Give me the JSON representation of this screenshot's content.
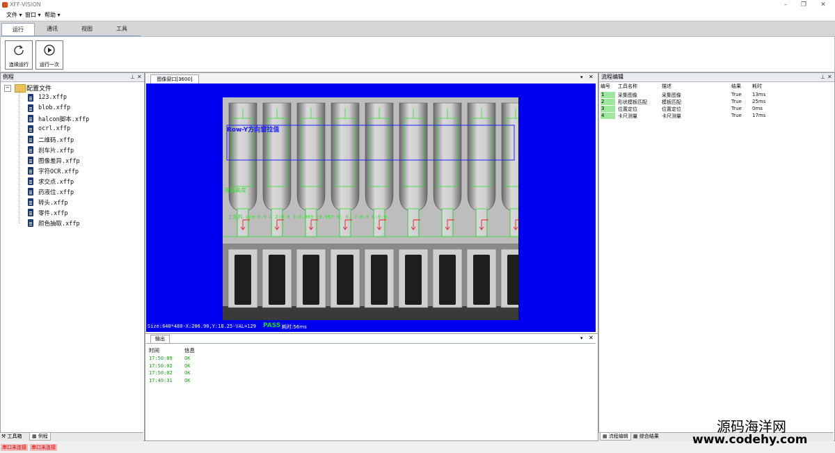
{
  "window": {
    "title": "XFF-VISION",
    "minimize": "–",
    "maximize": "❐",
    "close": "✕"
  },
  "menu": [
    "文件 ▾",
    "窗口 ▾",
    "帮助 ▾"
  ],
  "ribbon_tabs": [
    "运行",
    "通讯",
    "视图",
    "工具"
  ],
  "ribbon_buttons": {
    "continuous": "连续运行",
    "once": "运行一次"
  },
  "left_panel": {
    "title": "例程",
    "root": "配置文件",
    "files": [
      "123.xffp",
      "blob.xffp",
      "halcon脚本.xffp",
      "ocrl.xffp",
      "二维码.xffp",
      "刹车片.xffp",
      "图像差异.xffp",
      "字符OCR.xffp",
      "求交点.xffp",
      "药液位.xffp",
      "转头.xffp",
      "零件.xffp",
      "颜色抽取.xffp"
    ],
    "bottom_tabs": [
      "工具箱",
      "例程"
    ]
  },
  "image_window": {
    "tab": "图像窗口[3600]",
    "overlay_title": "Row-Y方向窗拉值",
    "overlay_left": "液面高度",
    "overlay_scores": "工配料    ore:0.9   4 2:0.9    3:0.969  :0.967 6: 0.  7:0.9  8:0.9",
    "status": "Size:640*480-X:206.90,Y:18.25-VAL=129",
    "result": "PASS",
    "time": "耗时:56ms"
  },
  "output": {
    "title": "输出",
    "columns": [
      "时间",
      "信息"
    ],
    "rows": [
      {
        "time": "17:50:09",
        "msg": "OK"
      },
      {
        "time": "17:50:02",
        "msg": "OK"
      },
      {
        "time": "17:50:02",
        "msg": "OK"
      },
      {
        "time": "17:49:31",
        "msg": "OK"
      }
    ]
  },
  "flow": {
    "title": "流程编辑",
    "columns": [
      "编号",
      "工具名称",
      "描述",
      "结果",
      "耗时"
    ],
    "rows": [
      {
        "id": "1",
        "name": "采集图像",
        "desc": "采集图像",
        "result": "True",
        "time": "13ms"
      },
      {
        "id": "2",
        "name": "形状模板匹配",
        "desc": "模板匹配",
        "result": "True",
        "time": "25ms"
      },
      {
        "id": "3",
        "name": "位置定位",
        "desc": "位置定位",
        "result": "True",
        "time": "0ms"
      },
      {
        "id": "4",
        "name": "卡尺测量",
        "desc": "卡尺测量",
        "result": "True",
        "time": "17ms"
      }
    ],
    "bottom_tabs": [
      "流程编辑",
      "综合结果"
    ]
  },
  "statusbar": [
    "串口未连接",
    "串口未连接"
  ],
  "watermark": {
    "line1": "源码海洋网",
    "line2": "www.codehy.com"
  }
}
